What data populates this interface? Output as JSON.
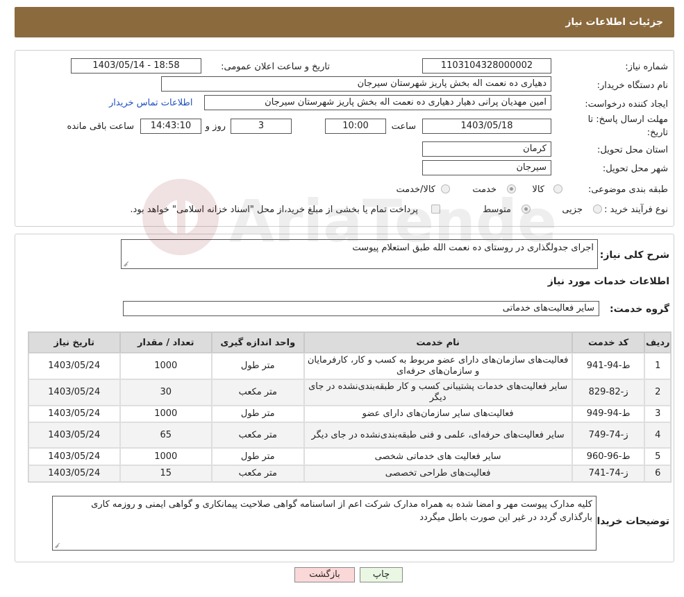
{
  "header": {
    "title": "جزئیات اطلاعات نیاز"
  },
  "form": {
    "need_number_label": "شماره نیاز:",
    "need_number": "1103104328000002",
    "announce_label": "تاریخ و ساعت اعلان عمومی:",
    "announce_value": "1403/05/14 - 18:58",
    "buyer_org_label": "نام دستگاه خریدار:",
    "buyer_org": "دهیاری ده نعمت اله بخش پاریز شهرستان سیرجان",
    "requester_label": "ایجاد کننده درخواست:",
    "requester": "امین مهدیان پرانی دهیار دهیاری ده نعمت اله بخش پاریز شهرستان سیرجان",
    "contact_link": "اطلاعات تماس خریدار",
    "deadline_label_line1": "مهلت ارسال پاسخ: تا",
    "deadline_label_line2": "تاریخ:",
    "deadline_date": "1403/05/18",
    "time_label": "ساعت",
    "deadline_time": "10:00",
    "days_value": "3",
    "days_label": "روز و",
    "remaining_time": "14:43:10",
    "remaining_label": "ساعت باقی مانده",
    "province_label": "استان محل تحویل:",
    "province": "کرمان",
    "city_label": "شهر محل تحویل:",
    "city": "سیرجان",
    "category_label": "طبقه بندی موضوعی:",
    "category_options": [
      "کالا",
      "خدمت",
      "کالا/خدمت"
    ],
    "process_label": "نوع فرآیند خرید :",
    "process_options": [
      "جزیی",
      "متوسط"
    ],
    "payment_note": "پرداخت تمام یا بخشی از مبلغ خرید،از محل \"اسناد خزانه اسلامی\" خواهد بود."
  },
  "summary": {
    "label": "شرح کلی نیاز:",
    "value": "اجرای جدولگذاری در روستای ده نعمت الله طبق استعلام پیوست"
  },
  "services": {
    "section_title": "اطلاعات خدمات مورد نیاز",
    "group_label": "گروه خدمت:",
    "group_value": "سایر فعالیت‌های خدماتی",
    "columns": [
      "ردیف",
      "کد خدمت",
      "نام خدمت",
      "واحد اندازه گیری",
      "تعداد / مقدار",
      "تاریخ نیاز"
    ],
    "rows": [
      [
        "1",
        "ط-94-941",
        "فعالیت‌های سازمان‌های دارای عضو مربوط به کسب و کار، کارفرمایان و سازمان‌های حرفه‌ای",
        "متر طول",
        "1000",
        "1403/05/24"
      ],
      [
        "2",
        "ز-82-829",
        "سایر فعالیت‌های خدمات پشتیبانی کسب و کار طبقه‌بندی‌نشده در جای دیگر",
        "متر مکعب",
        "30",
        "1403/05/24"
      ],
      [
        "3",
        "ط-94-949",
        "فعالیت‌های سایر سازمان‌های دارای عضو",
        "متر طول",
        "1000",
        "1403/05/24"
      ],
      [
        "4",
        "ز-74-749",
        "سایر فعالیت‌های حرفه‌ای، علمی و فنی طبقه‌بندی‌نشده در جای دیگر",
        "متر مکعب",
        "65",
        "1403/05/24"
      ],
      [
        "5",
        "ط-96-960",
        "سایر فعالیت های خدماتی شخصی",
        "متر طول",
        "1000",
        "1403/05/24"
      ],
      [
        "6",
        "ز-74-741",
        "فعالیت‌های طراحی تخصصی",
        "متر مکعب",
        "15",
        "1403/05/24"
      ]
    ]
  },
  "buyer_notes": {
    "label": "توضیحات خریدار:",
    "value": "کلیه مدارک پیوست مهر و امضا شده به همراه مدارک شرکت اعم از اساسنامه گواهی صلاحیت پیمانکاری و گواهی ایمنی و روزمه کاری بارگذاری گردد در غیر این  صورت باطل میگردد"
  },
  "buttons": {
    "print": "چاپ",
    "back": "بازگشت"
  },
  "watermark": {
    "text": "AriaTender.neT"
  },
  "colors": {
    "header_bg": "#8b6a3e",
    "link": "#1f4fbf",
    "back_btn": "#fbd8d8",
    "print_btn": "#e9f7e3"
  }
}
